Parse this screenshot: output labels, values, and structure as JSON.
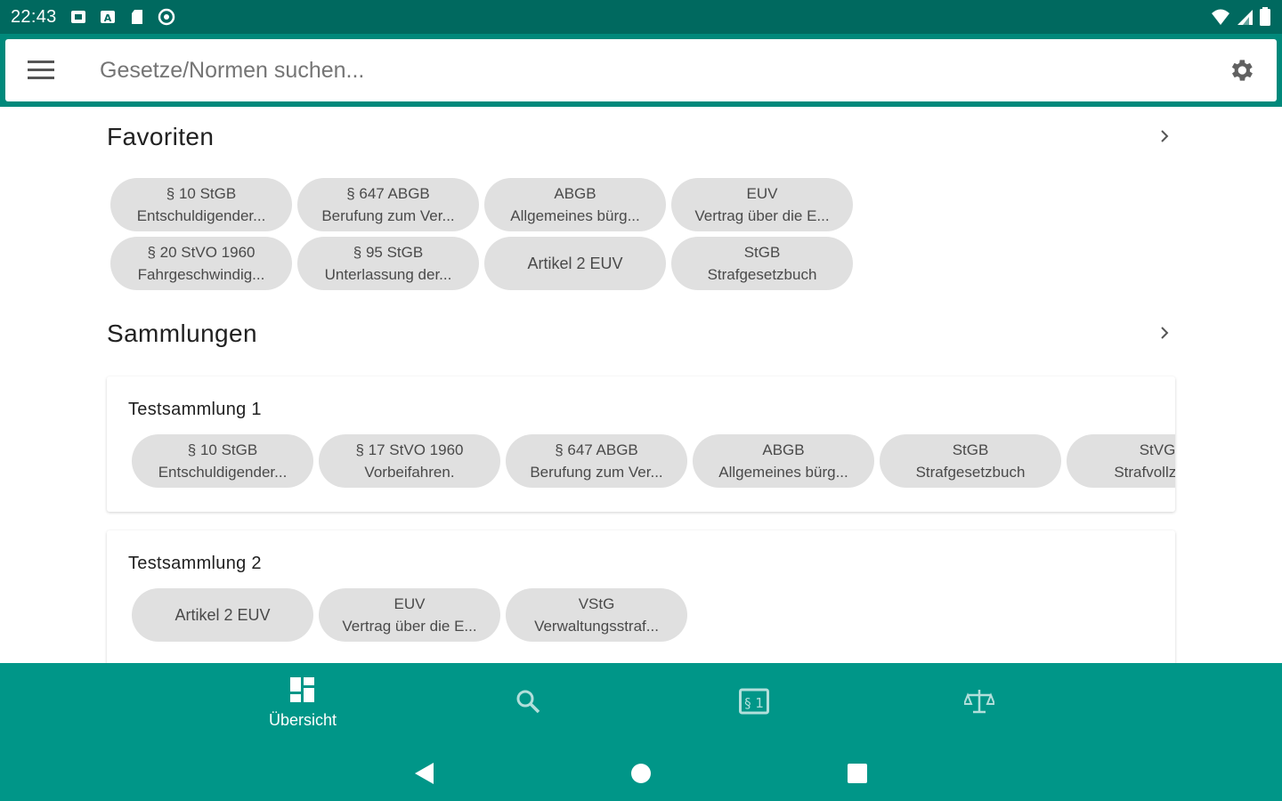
{
  "status_bar": {
    "time": "22:43",
    "icons": [
      "notification-icon",
      "notification-a-icon",
      "sd-card-icon",
      "sync-icon"
    ],
    "right_icons": [
      "wifi-icon",
      "signal-icon",
      "battery-icon"
    ]
  },
  "search": {
    "placeholder": "Gesetze/Normen suchen..."
  },
  "favorites": {
    "title": "Favoriten",
    "chips": [
      {
        "line1": "§ 10 StGB",
        "line2": "Entschuldigender..."
      },
      {
        "line1": "§ 647 ABGB",
        "line2": "Berufung zum Ver..."
      },
      {
        "line1": "ABGB",
        "line2": "Allgemeines bürg..."
      },
      {
        "line1": "EUV",
        "line2": "Vertrag über die E..."
      },
      {
        "line1": "§ 20 StVO 1960",
        "line2": "Fahrgeschwindig..."
      },
      {
        "line1": "§ 95 StGB",
        "line2": "Unterlassung der..."
      },
      {
        "line1": "Artikel 2 EUV",
        "line2": ""
      },
      {
        "line1": "StGB",
        "line2": "Strafgesetzbuch"
      }
    ]
  },
  "collections": {
    "title": "Sammlungen",
    "items": [
      {
        "title": "Testsammlung 1",
        "chips": [
          {
            "line1": "§ 10 StGB",
            "line2": "Entschuldigender..."
          },
          {
            "line1": "§ 17 StVO 1960",
            "line2": "Vorbeifahren."
          },
          {
            "line1": "§ 647 ABGB",
            "line2": "Berufung zum Ver..."
          },
          {
            "line1": "ABGB",
            "line2": "Allgemeines bürg..."
          },
          {
            "line1": "StGB",
            "line2": "Strafgesetzbuch"
          },
          {
            "line1": "StVG",
            "line2": "Strafvollzugs"
          }
        ]
      },
      {
        "title": "Testsammlung 2",
        "chips": [
          {
            "line1": "Artikel 2 EUV",
            "line2": ""
          },
          {
            "line1": "EUV",
            "line2": "Vertrag über die E..."
          },
          {
            "line1": "VStG",
            "line2": "Verwaltungsstraf..."
          }
        ]
      }
    ]
  },
  "bottom_nav": {
    "items": [
      {
        "label": "Übersicht",
        "icon": "dashboard-icon",
        "active": true
      },
      {
        "label": "",
        "icon": "search-icon",
        "active": false
      },
      {
        "label": "",
        "icon": "paragraph-book-icon",
        "active": false
      },
      {
        "label": "",
        "icon": "scales-icon",
        "active": false
      }
    ]
  },
  "colors": {
    "primary_dark": "#00695f",
    "primary": "#009688",
    "chip": "#e0e0e0"
  }
}
